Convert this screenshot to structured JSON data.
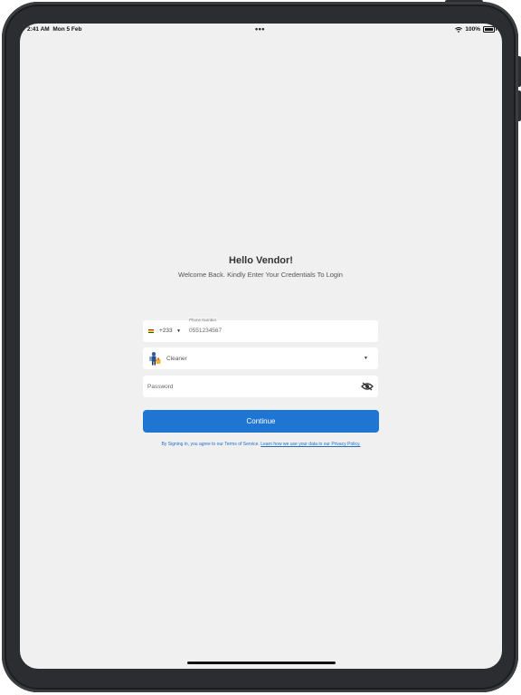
{
  "status_bar": {
    "time": "2:41 AM",
    "date": "Mon 5 Feb",
    "center_dots": "•••",
    "battery_percent": "100%",
    "icons": [
      "wifi-icon",
      "battery-icon"
    ]
  },
  "login": {
    "title": "Hello Vendor!",
    "subtitle": "Welcome Back. Kindly Enter Your Credentials To Login",
    "phone": {
      "label": "Phone Number",
      "country_code": "+233",
      "value": "0551234567",
      "flag_colors": [
        "#ce1126",
        "#fcd116",
        "#006b3f"
      ]
    },
    "role": {
      "value": "Cleaner",
      "icon": "cleaner-icon"
    },
    "password": {
      "placeholder": "Password",
      "toggle_icon": "eye-slash-icon"
    },
    "continue_label": "Continue",
    "terms_text": "By Signing in, you agree to our Terms of Service.",
    "privacy_link": "Learn how we use your data in our Privacy Policy."
  },
  "colors": {
    "primary": "#1f76d2",
    "background": "#f0f0f0",
    "field": "#ffffff"
  }
}
